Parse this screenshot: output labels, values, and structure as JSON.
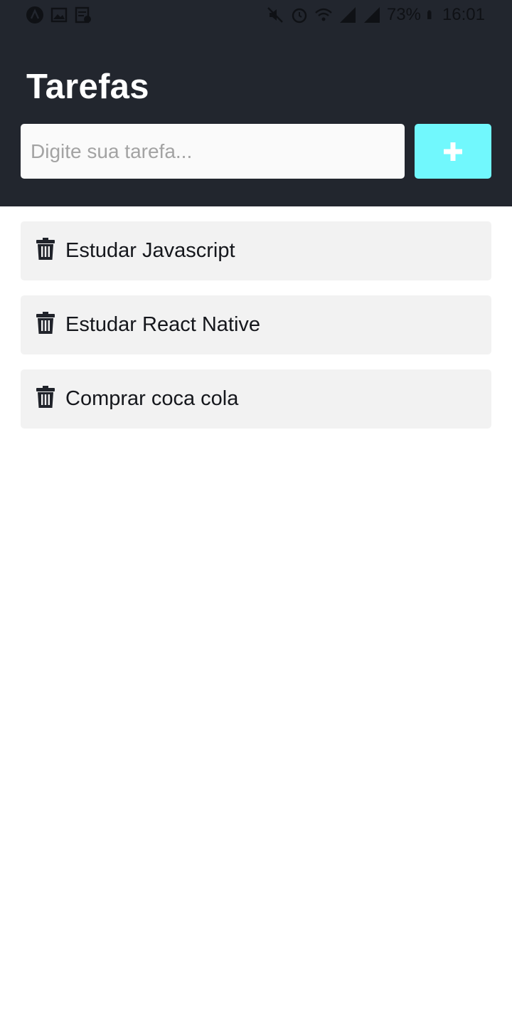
{
  "status_bar": {
    "battery_percent": "73%",
    "time": "16:01",
    "left_icons": [
      "app-icon",
      "image-icon",
      "notes-icon"
    ],
    "right_icons": [
      "mute-icon",
      "alarm-icon",
      "wifi-icon",
      "signal-icon",
      "signal-icon",
      "battery-icon"
    ]
  },
  "header": {
    "title": "Tarefas",
    "background_color": "#22262e"
  },
  "new_task": {
    "input_value": "",
    "placeholder": "Digite sua tarefa...",
    "add_button_icon": "plus-icon",
    "add_button_color": "#71f8fd"
  },
  "tasks": [
    {
      "label": "Estudar Javascript",
      "icon": "trash-icon"
    },
    {
      "label": "Estudar React Native",
      "icon": "trash-icon"
    },
    {
      "label": "Comprar coca cola",
      "icon": "trash-icon"
    }
  ]
}
